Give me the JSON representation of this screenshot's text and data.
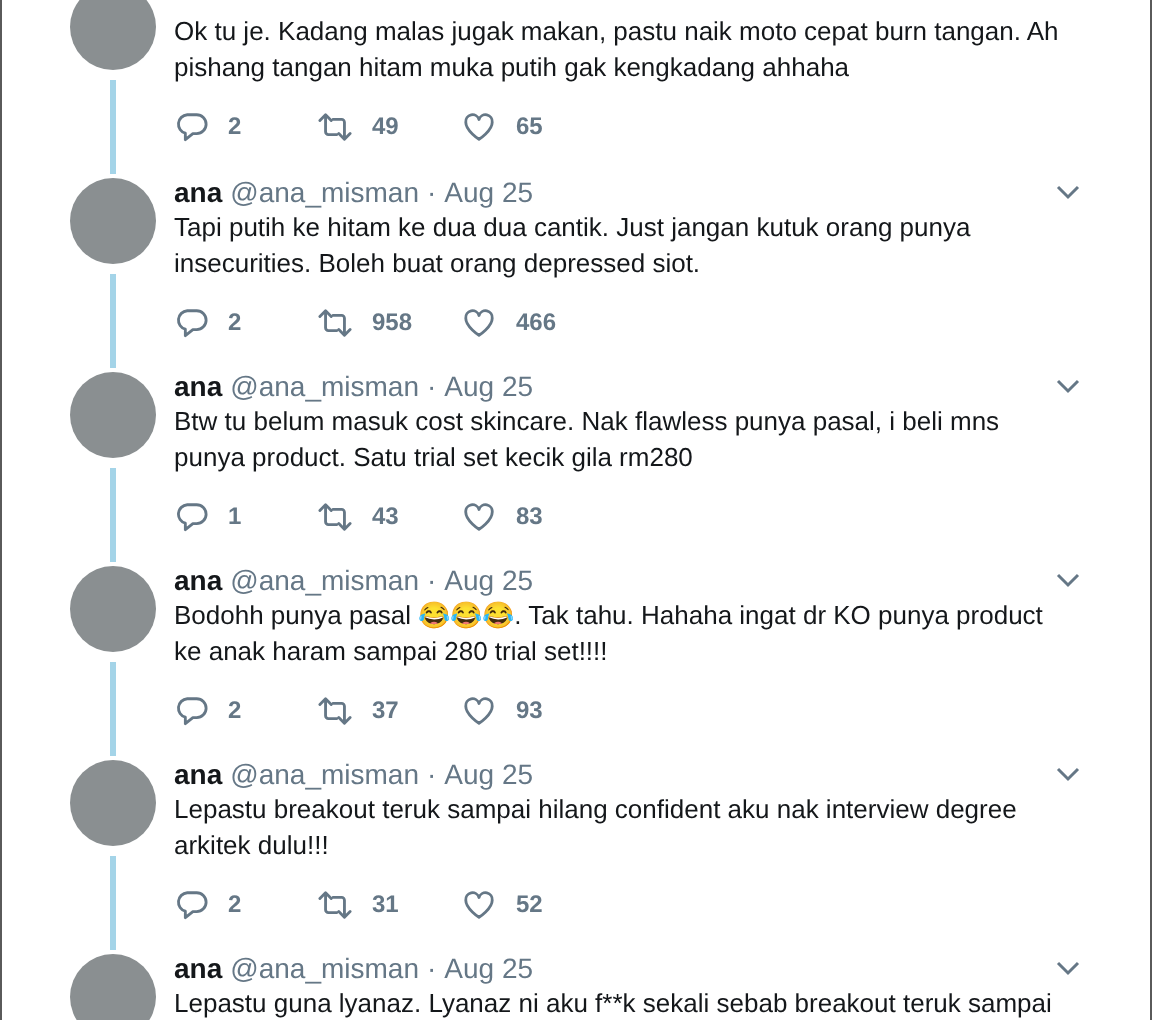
{
  "tweets": [
    {
      "text": "Ok tu je. Kadang malas jugak makan, pastu naik moto cepat burn tangan. Ah pishang tangan hitam muka putih gak kengkadang ahhaha",
      "replies": "2",
      "retweets": "49",
      "likes": "65"
    },
    {
      "name": "ana",
      "handle": "@ana_misman",
      "separator": "·",
      "date": "Aug 25",
      "text": "Tapi putih ke hitam ke dua dua cantik. Just jangan kutuk orang punya insecurities. Boleh buat orang depressed siot.",
      "replies": "2",
      "retweets": "958",
      "likes": "466"
    },
    {
      "name": "ana",
      "handle": "@ana_misman",
      "separator": "·",
      "date": "Aug 25",
      "text": "Btw tu belum masuk cost skincare. Nak flawless punya pasal, i beli mns punya product. Satu trial set kecik gila rm280",
      "replies": "1",
      "retweets": "43",
      "likes": "83"
    },
    {
      "name": "ana",
      "handle": "@ana_misman",
      "separator": "·",
      "date": "Aug 25",
      "text": "Bodohh punya pasal 😂😂😂. Tak tahu. Hahaha ingat dr KO punya product ke anak haram sampai 280 trial set!!!!",
      "replies": "2",
      "retweets": "37",
      "likes": "93"
    },
    {
      "name": "ana",
      "handle": "@ana_misman",
      "separator": "·",
      "date": "Aug 25",
      "text": "Lepastu breakout teruk sampai hilang confident aku nak interview degree arkitek dulu!!!",
      "replies": "2",
      "retweets": "31",
      "likes": "52"
    },
    {
      "name": "ana",
      "handle": "@ana_misman",
      "separator": "·",
      "date": "Aug 25",
      "text": "Lepastu guna lyanaz. Lyanaz ni aku f**k sekali sebab breakout teruk sampai"
    }
  ]
}
